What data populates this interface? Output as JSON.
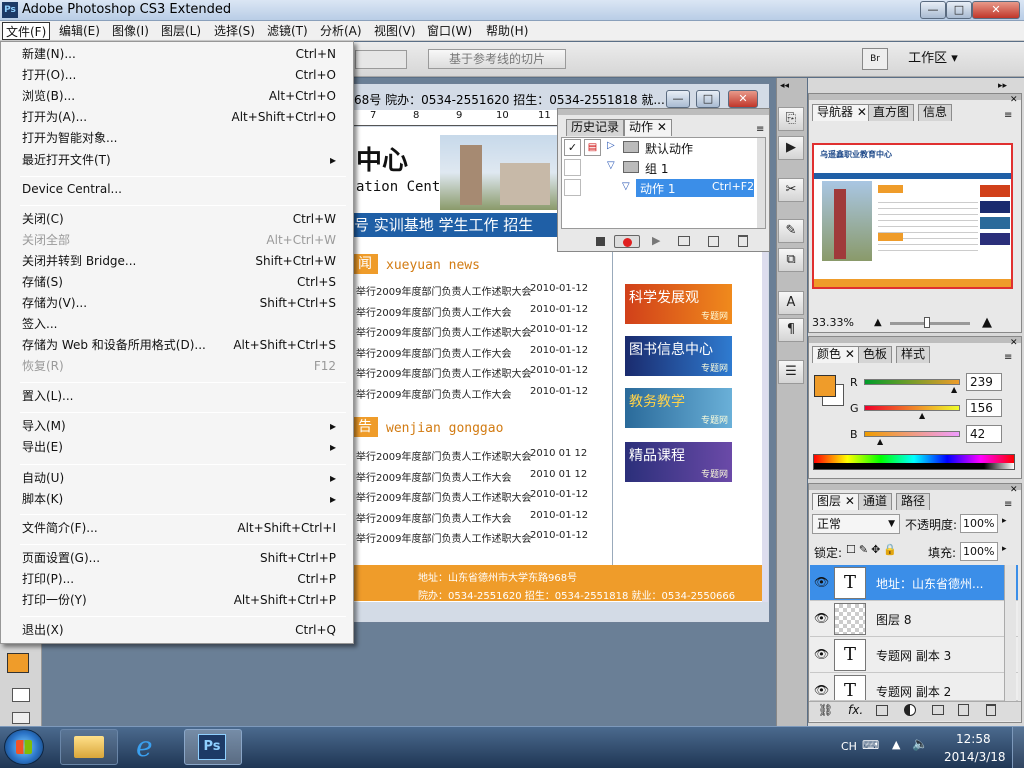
{
  "app": {
    "title": "Adobe Photoshop CS3 Extended",
    "logo": "Ps",
    "controls": {
      "minimize": "—",
      "maximize": "□",
      "close": "✕"
    }
  },
  "menubar": [
    "文件(F)",
    "编辑(E)",
    "图像(I)",
    "图层(L)",
    "选择(S)",
    "滤镜(T)",
    "分析(A)",
    "视图(V)",
    "窗口(W)",
    "帮助(H)"
  ],
  "options_bar": {
    "slice_button": "基于参考线的切片",
    "workspace": "工作区 ▾"
  },
  "file_menu": [
    {
      "label": "新建(N)...",
      "shortcut": "Ctrl+N"
    },
    {
      "label": "打开(O)...",
      "shortcut": "Ctrl+O"
    },
    {
      "label": "浏览(B)...",
      "shortcut": "Alt+Ctrl+O"
    },
    {
      "label": "打开为(A)...",
      "shortcut": "Alt+Shift+Ctrl+O"
    },
    {
      "label": "打开为智能对象...",
      "shortcut": ""
    },
    {
      "label": "最近打开文件(T)",
      "shortcut": "",
      "submenu": true
    },
    {
      "label": "Device Central...",
      "shortcut": ""
    },
    {
      "label": "关闭(C)",
      "shortcut": "Ctrl+W"
    },
    {
      "label": "关闭全部",
      "shortcut": "Alt+Ctrl+W",
      "disabled": true
    },
    {
      "label": "关闭并转到 Bridge...",
      "shortcut": "Shift+Ctrl+W"
    },
    {
      "label": "存储(S)",
      "shortcut": "Ctrl+S"
    },
    {
      "label": "存储为(V)...",
      "shortcut": "Shift+Ctrl+S"
    },
    {
      "label": "签入...",
      "shortcut": ""
    },
    {
      "label": "存储为 Web 和设备所用格式(D)...",
      "shortcut": "Alt+Shift+Ctrl+S"
    },
    {
      "label": "恢复(R)",
      "shortcut": "F12",
      "disabled": true
    },
    {
      "label": "置入(L)...",
      "shortcut": ""
    },
    {
      "label": "导入(M)",
      "shortcut": "",
      "submenu": true
    },
    {
      "label": "导出(E)",
      "shortcut": "",
      "submenu": true
    },
    {
      "label": "自动(U)",
      "shortcut": "",
      "submenu": true
    },
    {
      "label": "脚本(K)",
      "shortcut": "",
      "submenu": true
    },
    {
      "label": "文件简介(F)...",
      "shortcut": "Alt+Shift+Ctrl+I"
    },
    {
      "label": "页面设置(G)...",
      "shortcut": "Shift+Ctrl+P"
    },
    {
      "label": "打印(P)...",
      "shortcut": "Ctrl+P"
    },
    {
      "label": "打印一份(Y)",
      "shortcut": "Alt+Shift+Ctrl+P"
    },
    {
      "label": "退出(X)",
      "shortcut": "Ctrl+Q"
    }
  ],
  "document": {
    "title": "68号 院办：0534-2551620 招生：0534-2551818 就...",
    "ruler_numbers": [
      "7",
      "8",
      "9",
      "10",
      "11"
    ],
    "header_text": "中心",
    "header_sub": "ation Center",
    "nav": "号  实训基地  学生工作  招生",
    "news_heading": "闻",
    "news_heading_pinyin": "xueyuan news",
    "news_items": [
      {
        "title": "举行2009年度部门负责人工作述职大会",
        "date": "2010-01-12"
      },
      {
        "title": "举行2009年度部门负责人工作大会",
        "date": "2010-01-12"
      },
      {
        "title": "举行2009年度部门负责人工作述职大会",
        "date": "2010-01-12"
      },
      {
        "title": "举行2009年度部门负责人工作大会",
        "date": "2010-01-12"
      },
      {
        "title": "举行2009年度部门负责人工作述职大会",
        "date": "2010-01-12"
      },
      {
        "title": "举行2009年度部门负责人工作大会",
        "date": "2010-01-12"
      }
    ],
    "notice_heading": "告",
    "notice_heading_pinyin": "wenjian gonggao",
    "notice_items": [
      {
        "title": "举行2009年度部门负责人工作述职大会",
        "date": "2010 01 12"
      },
      {
        "title": "举行2009年度部门负责人工作大会",
        "date": "2010 01 12"
      },
      {
        "title": "举行2009年度部门负责人工作述职大会",
        "date": "2010-01-12"
      },
      {
        "title": "举行2009年度部门负责人工作大会",
        "date": "2010-01-12"
      },
      {
        "title": "举行2009年度部门负责人工作述职大会",
        "date": "2010-01-12"
      }
    ],
    "banners": [
      {
        "title": "科学发展观",
        "sub": "专题网"
      },
      {
        "title": "图书信息中心",
        "sub": "专题网"
      },
      {
        "title": "教务教学",
        "sub": "专题网"
      },
      {
        "title": "精品课程",
        "sub": "专题网"
      }
    ],
    "footer_line1": "地址：山东省德州市大学东路968号",
    "footer_line2": "院办：0534-2551620  招生：0534-2551818  就业：0534-2550666"
  },
  "actions_panel": {
    "tabs": [
      "历史记录",
      "动作"
    ],
    "items": [
      {
        "label": "默认动作",
        "shortcut": ""
      },
      {
        "label": "组 1",
        "shortcut": ""
      },
      {
        "label": "动作 1",
        "shortcut": "Ctrl+F2"
      }
    ]
  },
  "navigator": {
    "tabs": [
      "导航器",
      "直方图",
      "信息"
    ],
    "zoom": "33.33%",
    "thumb_title": "乌遥鑫职业教育中心"
  },
  "color_panel": {
    "tabs": [
      "颜色",
      "色板",
      "样式"
    ],
    "r_label": "R",
    "r": "239",
    "g_label": "G",
    "g": "156",
    "b_label": "B",
    "b": "42",
    "fg_color": "#ef9c2a"
  },
  "layers_panel": {
    "tabs": [
      "图层",
      "通道",
      "路径"
    ],
    "blend_mode": "正常",
    "opacity_label": "不透明度:",
    "opacity": "100%",
    "lock_label": "锁定:",
    "fill_label": "填充:",
    "fill": "100%",
    "layers": [
      {
        "name": "地址：山东省德州...",
        "type": "T",
        "selected": true
      },
      {
        "name": "图层 8",
        "type": "raster"
      },
      {
        "name": "专题网 副本 3",
        "type": "T"
      },
      {
        "name": "专题网 副本 2",
        "type": "T"
      }
    ]
  },
  "taskbar": {
    "lang": "CH",
    "time": "12:58",
    "date": "2014/3/18",
    "ps_label": "Ps"
  }
}
